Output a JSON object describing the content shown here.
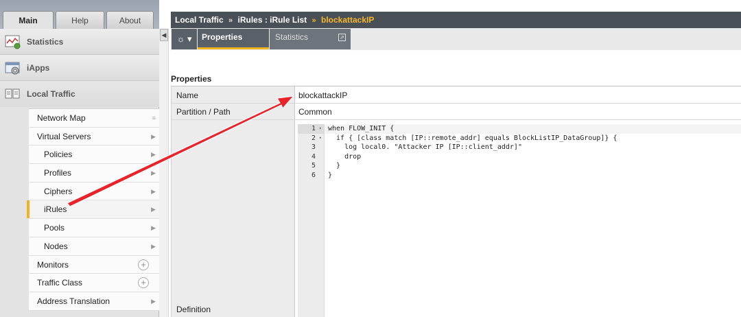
{
  "nav_tabs": {
    "main": "Main",
    "help": "Help",
    "about": "About"
  },
  "nav_sections": {
    "statistics": "Statistics",
    "iapps": "iApps",
    "local_traffic": "Local Traffic"
  },
  "submenu": [
    {
      "label": "Network Map",
      "indent": false,
      "marker": "grip"
    },
    {
      "label": "Virtual Servers",
      "indent": false,
      "marker": "arrow"
    },
    {
      "label": "Policies",
      "indent": true,
      "marker": "arrow"
    },
    {
      "label": "Profiles",
      "indent": true,
      "marker": "arrow"
    },
    {
      "label": "Ciphers",
      "indent": true,
      "marker": "arrow"
    },
    {
      "label": "iRules",
      "indent": true,
      "marker": "arrow",
      "selected": true
    },
    {
      "label": "Pools",
      "indent": true,
      "marker": "arrow"
    },
    {
      "label": "Nodes",
      "indent": true,
      "marker": "arrow"
    },
    {
      "label": "Monitors",
      "indent": false,
      "marker": "plus"
    },
    {
      "label": "Traffic Class",
      "indent": false,
      "marker": "plus"
    },
    {
      "label": "Address Translation",
      "indent": false,
      "marker": "arrow"
    }
  ],
  "breadcrumb": {
    "part1": "Local Traffic",
    "sep1": "»",
    "part2": "iRules : iRule List",
    "sep2": "»",
    "current": "blockattackIP"
  },
  "content_tabs": {
    "gear": "☼ ▾",
    "properties": "Properties",
    "statistics": "Statistics"
  },
  "properties": {
    "title": "Properties",
    "name_label": "Name",
    "name_value": "blockattackIP",
    "partition_label": "Partition / Path",
    "partition_value": "Common",
    "definition_label": "Definition"
  },
  "code_lines": [
    {
      "num": "1",
      "fold": "▾",
      "text": "when FLOW_INIT {"
    },
    {
      "num": "2",
      "fold": "▾",
      "text": "  if { [class match [IP::remote_addr] equals BlockListIP_DataGroup]} {"
    },
    {
      "num": "3",
      "fold": "",
      "text": "    log local0. \"Attacker IP [IP::client_addr]\""
    },
    {
      "num": "4",
      "fold": "",
      "text": "    drop"
    },
    {
      "num": "5",
      "fold": "",
      "text": "  }"
    },
    {
      "num": "6",
      "fold": "",
      "text": "}"
    }
  ],
  "colors": {
    "accent": "#f2b31f",
    "breadcrumb_bg": "#4a5057",
    "annotation_arrow": "#e8232a"
  }
}
